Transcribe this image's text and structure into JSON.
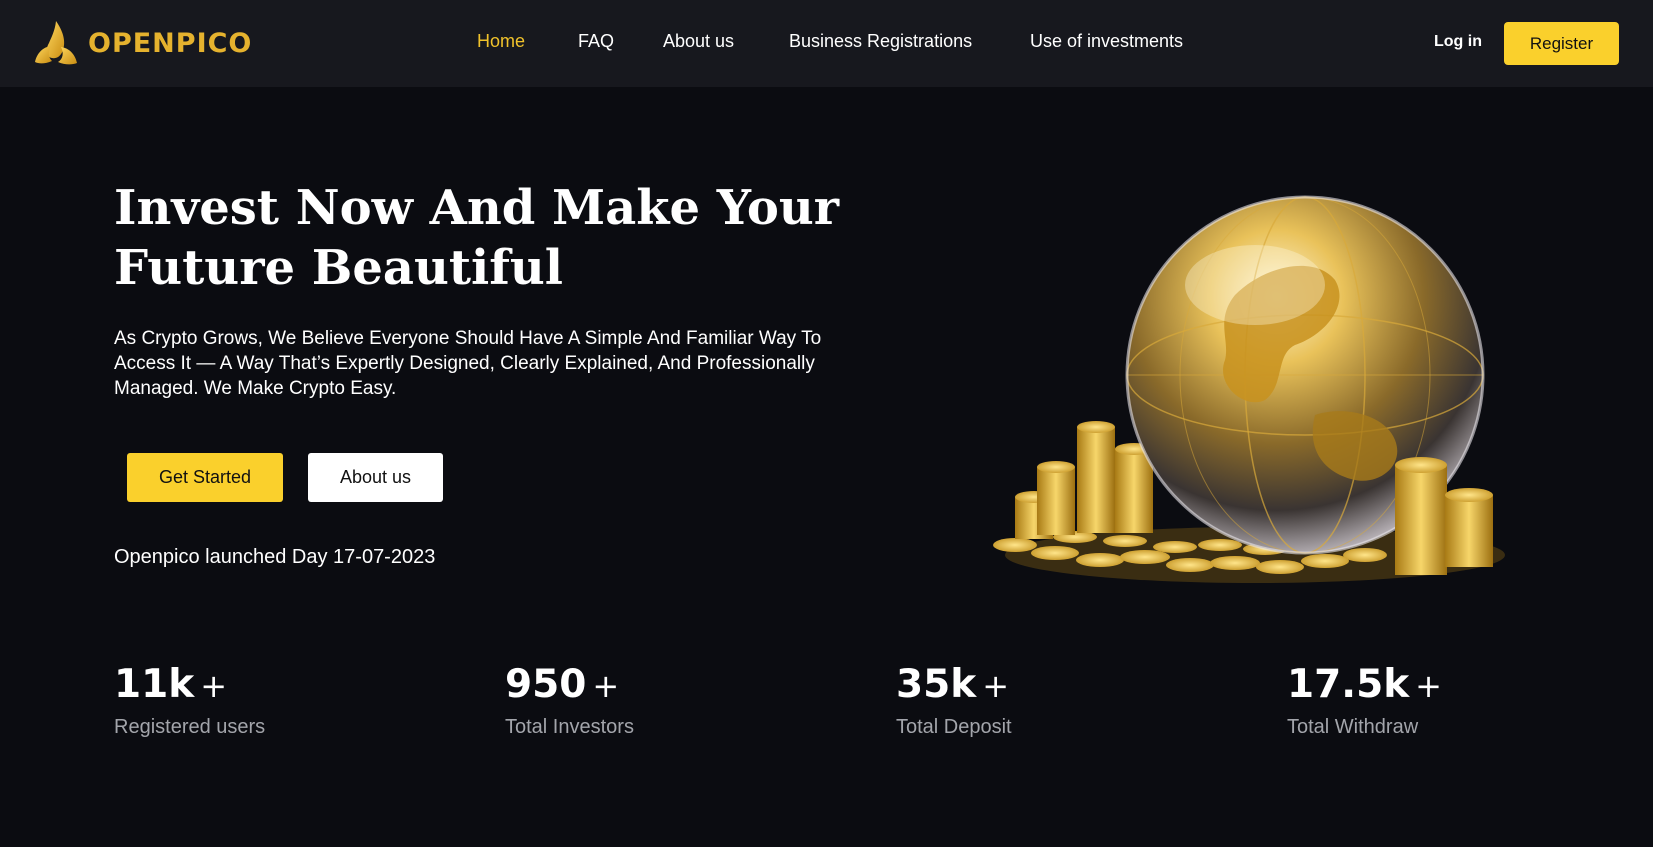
{
  "brand": {
    "name": "OPENPICO",
    "color": "#e5b22e"
  },
  "nav": {
    "items": [
      {
        "label": "Home",
        "active": true
      },
      {
        "label": "FAQ",
        "active": false
      },
      {
        "label": "About us",
        "active": false
      },
      {
        "label": "Business Registrations",
        "active": false
      },
      {
        "label": "Use of investments",
        "active": false
      }
    ],
    "login_label": "Log in",
    "register_label": "Register"
  },
  "hero": {
    "title_line1": "Invest Now And Make Your",
    "title_line2": "Future Beautiful",
    "subtitle": "As Crypto Grows, We Believe Everyone Should Have A Simple And Familiar Way To Access It — A Way That’s Expertly Designed, Clearly Explained, And Professionally Managed. We Make Crypto Easy.",
    "get_started_label": "Get Started",
    "about_label": "About us",
    "launched": "Openpico launched Day 17-07-2023",
    "image": "gold-globe-with-coins"
  },
  "stats": [
    {
      "value": "11k",
      "plus": "+",
      "label": "Registered users"
    },
    {
      "value": "950",
      "plus": "+",
      "label": "Total Investors"
    },
    {
      "value": "35k",
      "plus": "+",
      "label": "Total Deposit"
    },
    {
      "value": "17.5k",
      "plus": "+",
      "label": "Total Withdraw"
    }
  ],
  "colors": {
    "accent": "#fad02c",
    "active_nav": "#f0c22b",
    "background": "#0b0c11",
    "navbar": "#17181e",
    "muted_text": "#a3a5ab"
  }
}
